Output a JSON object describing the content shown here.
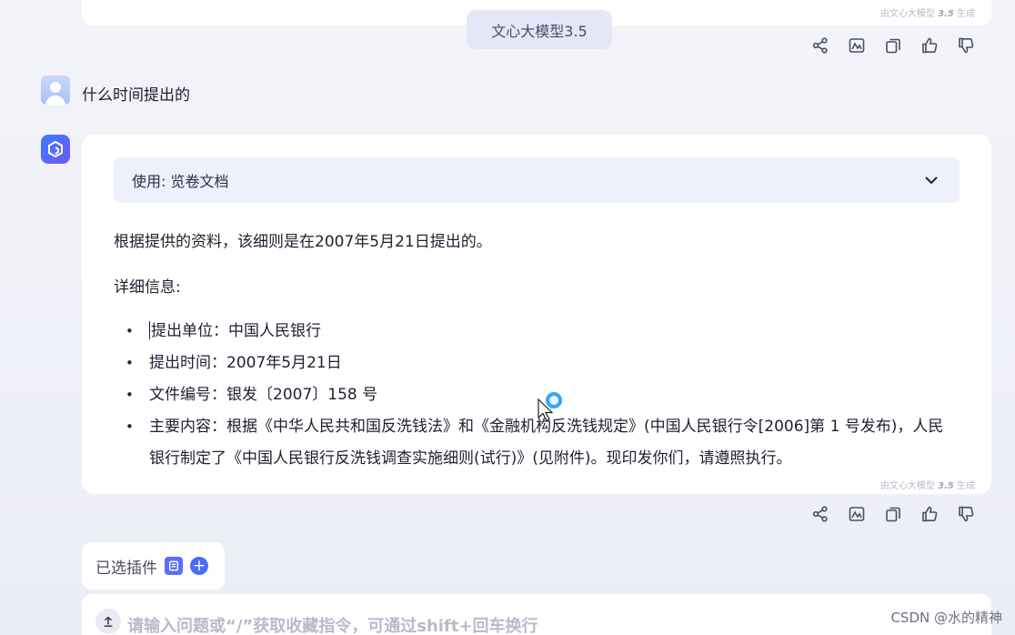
{
  "model_badge": "文心大模型3.5",
  "gen_tag": {
    "prefix": "由文心大模型",
    "version": "3.5",
    "suffix": "生成"
  },
  "user_message": "什么时间提出的",
  "answer": {
    "tool_label": "使用: 览卷文档",
    "intro": "根据提供的资料，该细则是在2007年5月21日提出的。",
    "detail_heading": "详细信息:",
    "bullets": [
      "提出单位：中国人民银行",
      "提出时间：2007年5月21日",
      "文件编号：银发〔2007〕158 号",
      "主要内容：根据《中华人民共和国反洗钱法》和《金融机构反洗钱规定》(中国人民银行令[2006]第 1 号发布)，人民银行制定了《中国人民银行反洗钱调查实施细则(试行)》(见附件)。现印发你们，请遵照执行。"
    ]
  },
  "actions": [
    "share-icon",
    "image-icon",
    "copy-icon",
    "thumbs-up-icon",
    "thumbs-down-icon"
  ],
  "plugins": {
    "label": "已选插件"
  },
  "input": {
    "placeholder": "请输入问题或“/”获取收藏指令，可通过shift+回车换行"
  },
  "watermark": "CSDN @水的精神"
}
